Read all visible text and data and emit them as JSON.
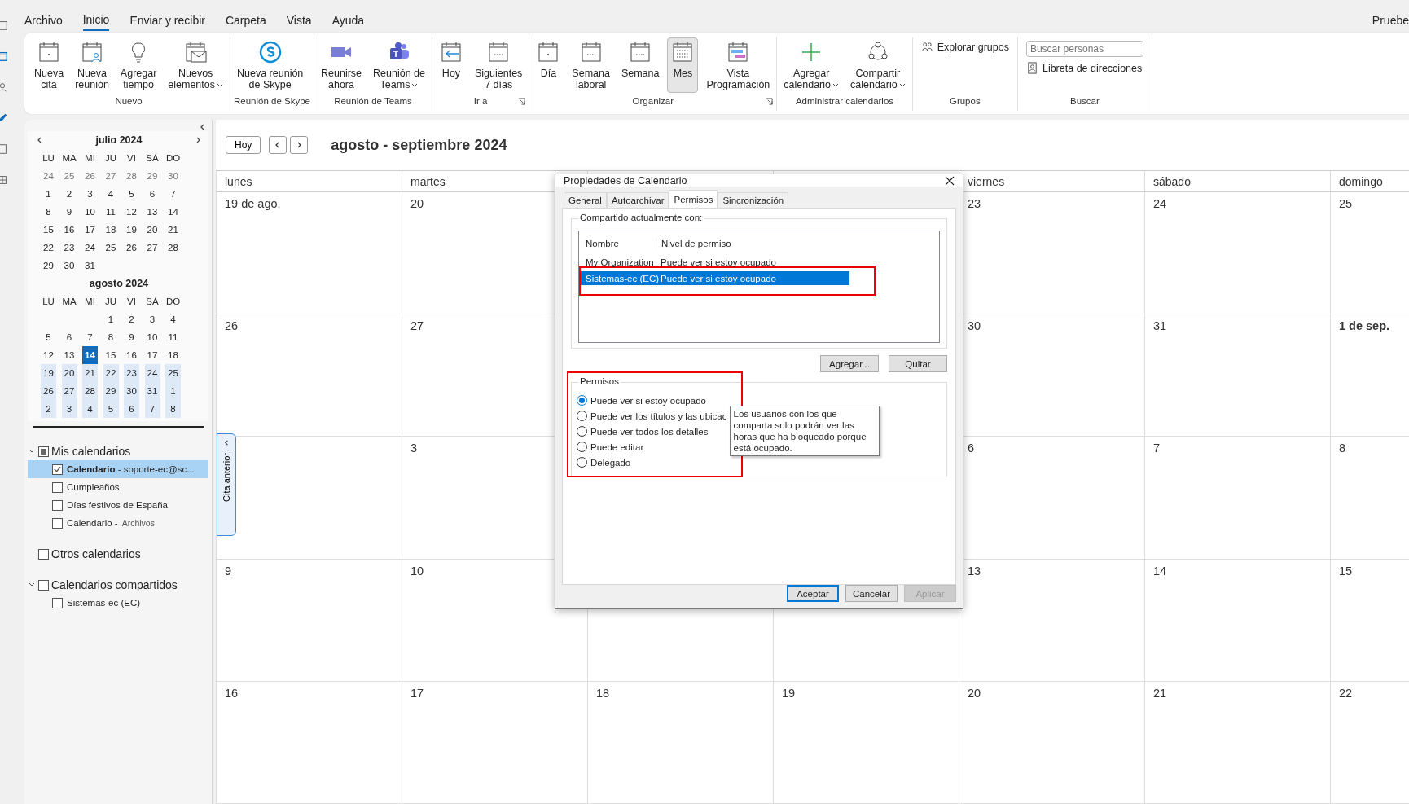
{
  "menu": {
    "tabs": [
      {
        "label": "Archivo",
        "selected": false
      },
      {
        "label": "Inicio",
        "selected": true
      },
      {
        "label": "Enviar y recibir",
        "selected": false
      },
      {
        "label": "Carpeta",
        "selected": false
      },
      {
        "label": "Vista",
        "selected": false
      },
      {
        "label": "Ayuda",
        "selected": false
      }
    ],
    "right_text": "Pruebe"
  },
  "ribbon": [
    {
      "label": "Nuevo",
      "kind": "large",
      "launcher": false,
      "buttons": [
        {
          "label": "Nueva\ncita",
          "dropdown": false,
          "selected": false
        },
        {
          "label": "Nueva\nreunión",
          "dropdown": false,
          "selected": false
        },
        {
          "label": "Agregar\ntiempo",
          "dropdown": false,
          "selected": false
        },
        {
          "label": "Nuevos\nelementos",
          "dropdown": true,
          "selected": false
        }
      ]
    },
    {
      "label": "Reunión de Skype",
      "kind": "large",
      "launcher": false,
      "buttons": [
        {
          "label": "Nueva reunión\nde Skype",
          "dropdown": false,
          "selected": false
        }
      ]
    },
    {
      "label": "Reunión de Teams",
      "kind": "large",
      "launcher": false,
      "buttons": [
        {
          "label": "Reunirse\nahora",
          "dropdown": false,
          "selected": false
        },
        {
          "label": "Reunión de\nTeams",
          "dropdown": true,
          "selected": false
        }
      ]
    },
    {
      "label": "Ir a",
      "kind": "large",
      "launcher": true,
      "buttons": [
        {
          "label": "Hoy",
          "dropdown": false,
          "selected": false
        },
        {
          "label": "Siguientes\n7 días",
          "dropdown": false,
          "selected": false
        }
      ]
    },
    {
      "label": "Organizar",
      "kind": "large",
      "launcher": true,
      "buttons": [
        {
          "label": "Día",
          "dropdown": false,
          "selected": false
        },
        {
          "label": "Semana\nlaboral",
          "dropdown": false,
          "selected": false
        },
        {
          "label": "Semana",
          "dropdown": false,
          "selected": false
        },
        {
          "label": "Mes",
          "dropdown": false,
          "selected": true
        },
        {
          "label": "Vista\nProgramación",
          "dropdown": false,
          "selected": false
        }
      ]
    },
    {
      "label": "Administrar calendarios",
      "kind": "large",
      "launcher": false,
      "buttons": [
        {
          "label": "Agregar\ncalendario",
          "dropdown": true,
          "selected": false
        },
        {
          "label": "Compartir\ncalendario",
          "dropdown": true,
          "selected": false
        }
      ]
    },
    {
      "label": "Grupos",
      "kind": "links",
      "links": [
        "Explorar grupos"
      ]
    },
    {
      "label": "Buscar",
      "kind": "search",
      "placeholder": "Buscar personas",
      "links": [
        "Libreta de direcciones"
      ]
    }
  ],
  "mini_calendars": [
    {
      "title": "julio 2024",
      "weekdays": [
        "LU",
        "MA",
        "MI",
        "JU",
        "VI",
        "SÁ",
        "DO"
      ],
      "weeks": [
        {
          "dimmed": true,
          "in_view": false,
          "days": [
            {
              "d": "24",
              "selected": false
            },
            {
              "d": "25",
              "selected": false
            },
            {
              "d": "26",
              "selected": false
            },
            {
              "d": "27",
              "selected": false
            },
            {
              "d": "28",
              "selected": false
            },
            {
              "d": "29",
              "selected": false
            },
            {
              "d": "30",
              "selected": false
            }
          ]
        },
        {
          "dimmed": false,
          "in_view": false,
          "days": [
            {
              "d": "1",
              "selected": false
            },
            {
              "d": "2",
              "selected": false
            },
            {
              "d": "3",
              "selected": false
            },
            {
              "d": "4",
              "selected": false
            },
            {
              "d": "5",
              "selected": false
            },
            {
              "d": "6",
              "selected": false
            },
            {
              "d": "7",
              "selected": false
            }
          ]
        },
        {
          "dimmed": false,
          "in_view": false,
          "days": [
            {
              "d": "8",
              "selected": false
            },
            {
              "d": "9",
              "selected": false
            },
            {
              "d": "10",
              "selected": false
            },
            {
              "d": "11",
              "selected": false
            },
            {
              "d": "12",
              "selected": false
            },
            {
              "d": "13",
              "selected": false
            },
            {
              "d": "14",
              "selected": false
            }
          ]
        },
        {
          "dimmed": false,
          "in_view": false,
          "days": [
            {
              "d": "15",
              "selected": false
            },
            {
              "d": "16",
              "selected": false
            },
            {
              "d": "17",
              "selected": false
            },
            {
              "d": "18",
              "selected": false
            },
            {
              "d": "19",
              "selected": false
            },
            {
              "d": "20",
              "selected": false
            },
            {
              "d": "21",
              "selected": false
            }
          ]
        },
        {
          "dimmed": false,
          "in_view": false,
          "days": [
            {
              "d": "22",
              "selected": false
            },
            {
              "d": "23",
              "selected": false
            },
            {
              "d": "24",
              "selected": false
            },
            {
              "d": "25",
              "selected": false
            },
            {
              "d": "26",
              "selected": false
            },
            {
              "d": "27",
              "selected": false
            },
            {
              "d": "28",
              "selected": false
            }
          ]
        },
        {
          "dimmed": false,
          "in_view": false,
          "days": [
            {
              "d": "29",
              "selected": false
            },
            {
              "d": "30",
              "selected": false
            },
            {
              "d": "31",
              "selected": false
            }
          ]
        }
      ]
    },
    {
      "title": "agosto 2024",
      "weekdays": [
        "LU",
        "MA",
        "MI",
        "JU",
        "VI",
        "SÁ",
        "DO"
      ],
      "weeks": [
        {
          "dimmed": false,
          "in_view": false,
          "starts_midweek": true,
          "days": [
            {
              "d": "1",
              "selected": false
            },
            {
              "d": "2",
              "selected": false
            },
            {
              "d": "3",
              "selected": false
            },
            {
              "d": "4",
              "selected": false
            }
          ]
        },
        {
          "dimmed": false,
          "in_view": false,
          "days": [
            {
              "d": "5",
              "selected": false
            },
            {
              "d": "6",
              "selected": false
            },
            {
              "d": "7",
              "selected": false
            },
            {
              "d": "8",
              "selected": false
            },
            {
              "d": "9",
              "selected": false
            },
            {
              "d": "10",
              "selected": false
            },
            {
              "d": "11",
              "selected": false
            }
          ]
        },
        {
          "dimmed": false,
          "in_view": false,
          "days": [
            {
              "d": "12",
              "selected": false
            },
            {
              "d": "13",
              "selected": false
            },
            {
              "d": "14",
              "selected": true
            },
            {
              "d": "15",
              "selected": false
            },
            {
              "d": "16",
              "selected": false
            },
            {
              "d": "17",
              "selected": false
            },
            {
              "d": "18",
              "selected": false
            }
          ]
        },
        {
          "dimmed": false,
          "in_view": true,
          "days": [
            {
              "d": "19",
              "selected": false
            },
            {
              "d": "20",
              "selected": false
            },
            {
              "d": "21",
              "selected": false
            },
            {
              "d": "22",
              "selected": false
            },
            {
              "d": "23",
              "selected": false
            },
            {
              "d": "24",
              "selected": false
            },
            {
              "d": "25",
              "selected": false
            }
          ]
        },
        {
          "dimmed": false,
          "in_view": true,
          "days": [
            {
              "d": "26",
              "selected": false
            },
            {
              "d": "27",
              "selected": false
            },
            {
              "d": "28",
              "selected": false
            },
            {
              "d": "29",
              "selected": false
            },
            {
              "d": "30",
              "selected": false
            },
            {
              "d": "31",
              "selected": false
            },
            {
              "d": "1",
              "selected": false
            }
          ]
        },
        {
          "dimmed": false,
          "in_view": true,
          "days": [
            {
              "d": "2",
              "selected": false
            },
            {
              "d": "3",
              "selected": false
            },
            {
              "d": "4",
              "selected": false
            },
            {
              "d": "5",
              "selected": false
            },
            {
              "d": "6",
              "selected": false
            },
            {
              "d": "7",
              "selected": false
            },
            {
              "d": "8",
              "selected": false
            }
          ]
        }
      ]
    }
  ],
  "folders": [
    {
      "label": "Mis calendarios",
      "expanded": true,
      "partial": true,
      "items": [
        {
          "name": "**Calendario** - soporte-ec@sc...",
          "checked": true,
          "selected": true
        },
        {
          "name": "Cumpleaños",
          "checked": false,
          "selected": false
        },
        {
          "name": "Días festivos de España",
          "checked": false,
          "selected": false
        },
        {
          "name": "Calendario -",
          "detail": "Archivos",
          "checked": false,
          "selected": false
        }
      ]
    },
    {
      "label": "Otros calendarios",
      "expanded": false,
      "partial": false
    },
    {
      "label": "Calendarios compartidos",
      "expanded": true,
      "partial": false,
      "items": [
        {
          "name": "Sistemas-ec (EC)",
          "checked": false,
          "selected": false
        }
      ]
    }
  ],
  "side_tab": "Cita anterior",
  "calendar": {
    "today_button": "Hoy",
    "title": "agosto - septiembre 2024",
    "header": {
      "kind": "split",
      "labels": [
        "lunes",
        "martes",
        "viernes",
        "sábado",
        "domingo"
      ]
    },
    "weeks": [
      {
        "kind": "split",
        "cells": [
          {
            "label": "19 de ago.",
            "bold": false
          },
          {
            "label": "20",
            "bold": false
          },
          {
            "label": "23",
            "bold": false
          },
          {
            "label": "24",
            "bold": false
          },
          {
            "label": "25",
            "bold": false
          }
        ]
      },
      {
        "kind": "split",
        "cells": [
          {
            "label": "26",
            "bold": false
          },
          {
            "label": "27",
            "bold": false
          },
          {
            "label": "30",
            "bold": false
          },
          {
            "label": "31",
            "bold": false
          },
          {
            "label": "1 de sep.",
            "bold": true
          }
        ]
      },
      {
        "kind": "split_late",
        "cells": [
          {
            "label": "3",
            "bold": false
          },
          {
            "label": "6",
            "bold": false
          },
          {
            "label": "7",
            "bold": false
          },
          {
            "label": "8",
            "bold": false
          }
        ]
      },
      {
        "kind": "split",
        "cells": [
          {
            "label": "9",
            "bold": false
          },
          {
            "label": "10",
            "bold": false
          },
          {
            "label": "13",
            "bold": false
          },
          {
            "label": "14",
            "bold": false
          },
          {
            "label": "15",
            "bold": false
          }
        ]
      },
      {
        "kind": "full",
        "cells": [
          {
            "label": "16",
            "bold": false
          },
          {
            "label": "17",
            "bold": false
          },
          {
            "label": "18",
            "bold": false
          },
          {
            "label": "19",
            "bold": false
          },
          {
            "label": "20",
            "bold": false
          },
          {
            "label": "21",
            "bold": false
          },
          {
            "label": "22",
            "bold": false
          }
        ]
      }
    ]
  },
  "dialog": {
    "title": "Propiedades de Calendario",
    "tabs": [
      {
        "label": "General",
        "selected": false
      },
      {
        "label": "Autoarchivar",
        "selected": false
      },
      {
        "label": "Permisos",
        "selected": true
      },
      {
        "label": "Sincronización",
        "selected": false
      }
    ],
    "shared_group": "Compartido actualmente con:",
    "columns": [
      "Nombre",
      "Nivel de permiso"
    ],
    "rows": [
      {
        "cells": [
          "My Organization",
          "Puede ver si estoy ocupado"
        ],
        "selected": false,
        "highlighted": false
      },
      {
        "cells": [
          "Sistemas-ec (EC)",
          "Puede ver si estoy ocupado"
        ],
        "selected": true,
        "highlighted": true
      }
    ],
    "list_buttons": [
      "Agregar...",
      "Quitar"
    ],
    "permissions": {
      "label": "Permisos",
      "highlighted": true,
      "options": [
        {
          "label": "Puede ver si estoy ocupado",
          "selected": true
        },
        {
          "label": "Puede ver los títulos y las ubicac",
          "selected": false
        },
        {
          "label": "Puede ver todos los detalles",
          "selected": false
        },
        {
          "label": "Puede editar",
          "selected": false
        },
        {
          "label": "Delegado",
          "selected": false
        }
      ]
    },
    "tooltip": "Los usuarios con los que comparta solo podrán ver las horas que ha bloqueado porque está ocupado.",
    "buttons": [
      {
        "label": "Aceptar",
        "default": true,
        "disabled": false
      },
      {
        "label": "Cancelar",
        "default": false,
        "disabled": false
      },
      {
        "label": "Aplicar",
        "default": false,
        "disabled": true
      }
    ]
  }
}
